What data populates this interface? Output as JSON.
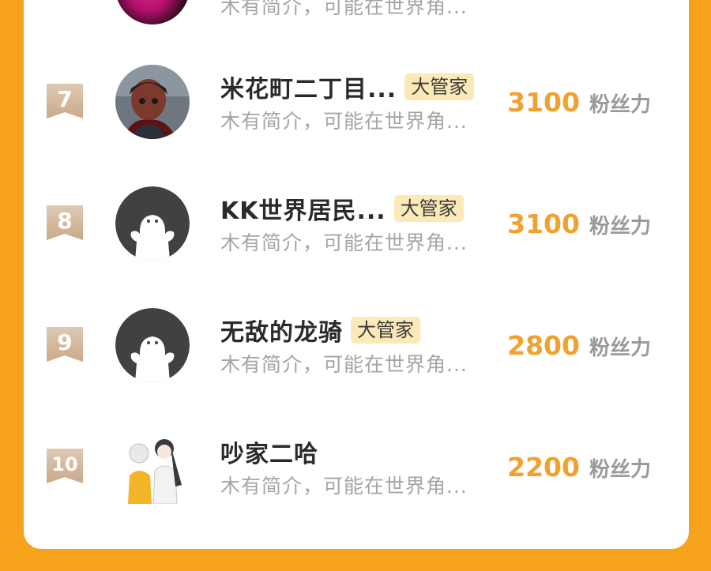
{
  "rows": [
    {
      "rank": "",
      "name": "",
      "badge": "",
      "bio": "木有简介，可能在世界角...",
      "fans": "",
      "fans_label": ""
    },
    {
      "rank": "7",
      "name": "米花町二丁目...",
      "badge": "大管家",
      "bio": "木有简介，可能在世界角...",
      "fans": "3100",
      "fans_label": "粉丝力"
    },
    {
      "rank": "8",
      "name": "KK世界居民...",
      "badge": "大管家",
      "bio": "木有简介，可能在世界角...",
      "fans": "3100",
      "fans_label": "粉丝力"
    },
    {
      "rank": "9",
      "name": "无敌的龙骑",
      "badge": "大管家",
      "bio": "木有简介，可能在世界角...",
      "fans": "2800",
      "fans_label": "粉丝力"
    },
    {
      "rank": "10",
      "name": "吵家二哈",
      "badge": "",
      "bio": "木有简介，可能在世界角...",
      "fans": "2200",
      "fans_label": "粉丝力"
    }
  ],
  "colors": {
    "background": "#f7a21d",
    "fans_number": "#f0a12f",
    "badge_bg": "#fbeab8",
    "rank_ribbon": "#caa989"
  },
  "icons": {
    "default_avatar": "ghost-person-avatar-icon"
  }
}
